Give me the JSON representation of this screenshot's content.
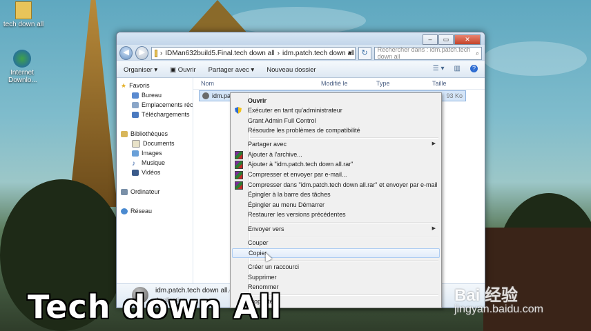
{
  "desktop": {
    "icons": [
      {
        "label": "tech down all",
        "icon": "folder-icon"
      },
      {
        "label": "Internet Downlo...",
        "icon": "idm-icon"
      }
    ]
  },
  "window": {
    "breadcrumb": [
      "IDMan632build5.Final.tech down all",
      "idm.patch.tech down all"
    ],
    "search_placeholder": "Rechercher dans : idm.patch.tech down all",
    "toolbar": {
      "organize": "Organiser",
      "open": "Ouvrir",
      "share": "Partager avec",
      "new_folder": "Nouveau dossier"
    },
    "nav": {
      "favorites": "Favoris",
      "desktop": "Bureau",
      "recent": "Emplacements récents",
      "downloads": "Téléchargements",
      "libraries": "Bibliothèques",
      "documents": "Documents",
      "images": "Images",
      "music": "Musique",
      "videos": "Vidéos",
      "computer": "Ordinateur",
      "network": "Réseau"
    },
    "columns": {
      "name": "Nom",
      "modified": "Modifié le",
      "type": "Type",
      "size": "Taille"
    },
    "file": {
      "name": "idm.patch.tech down all.exe",
      "size": "93 Ko"
    },
    "details": {
      "name": "idm.patch.tech down all.exe",
      "type": "Application"
    }
  },
  "context_menu": {
    "items": [
      "Ouvrir",
      "Exécuter en tant qu'administrateur",
      "Grant Admin Full Control",
      "Résoudre les problèmes de compatibilité",
      "Partager avec",
      "Ajouter à l'archive...",
      "Ajouter à \"idm.patch.tech down all.rar\"",
      "Compresser et envoyer par e-mail...",
      "Compresser dans \"idm.patch.tech down all.rar\" et envoyer par e-mail",
      "Épingler à la barre des tâches",
      "Épingler au menu Démarrer",
      "Restaurer les versions précédentes",
      "Envoyer vers",
      "Couper",
      "Copier",
      "Créer un raccourci",
      "Supprimer",
      "Renommer",
      "Propriétés"
    ]
  },
  "overlay": {
    "watermark": "Tech down All",
    "baidu": "Bai 经验",
    "baidu_url": "jingyan.baidu.com"
  },
  "colors": {
    "selection": "#d4e5f8",
    "menu_hover": "#e1ecfa",
    "close_button": "#c3442a"
  }
}
